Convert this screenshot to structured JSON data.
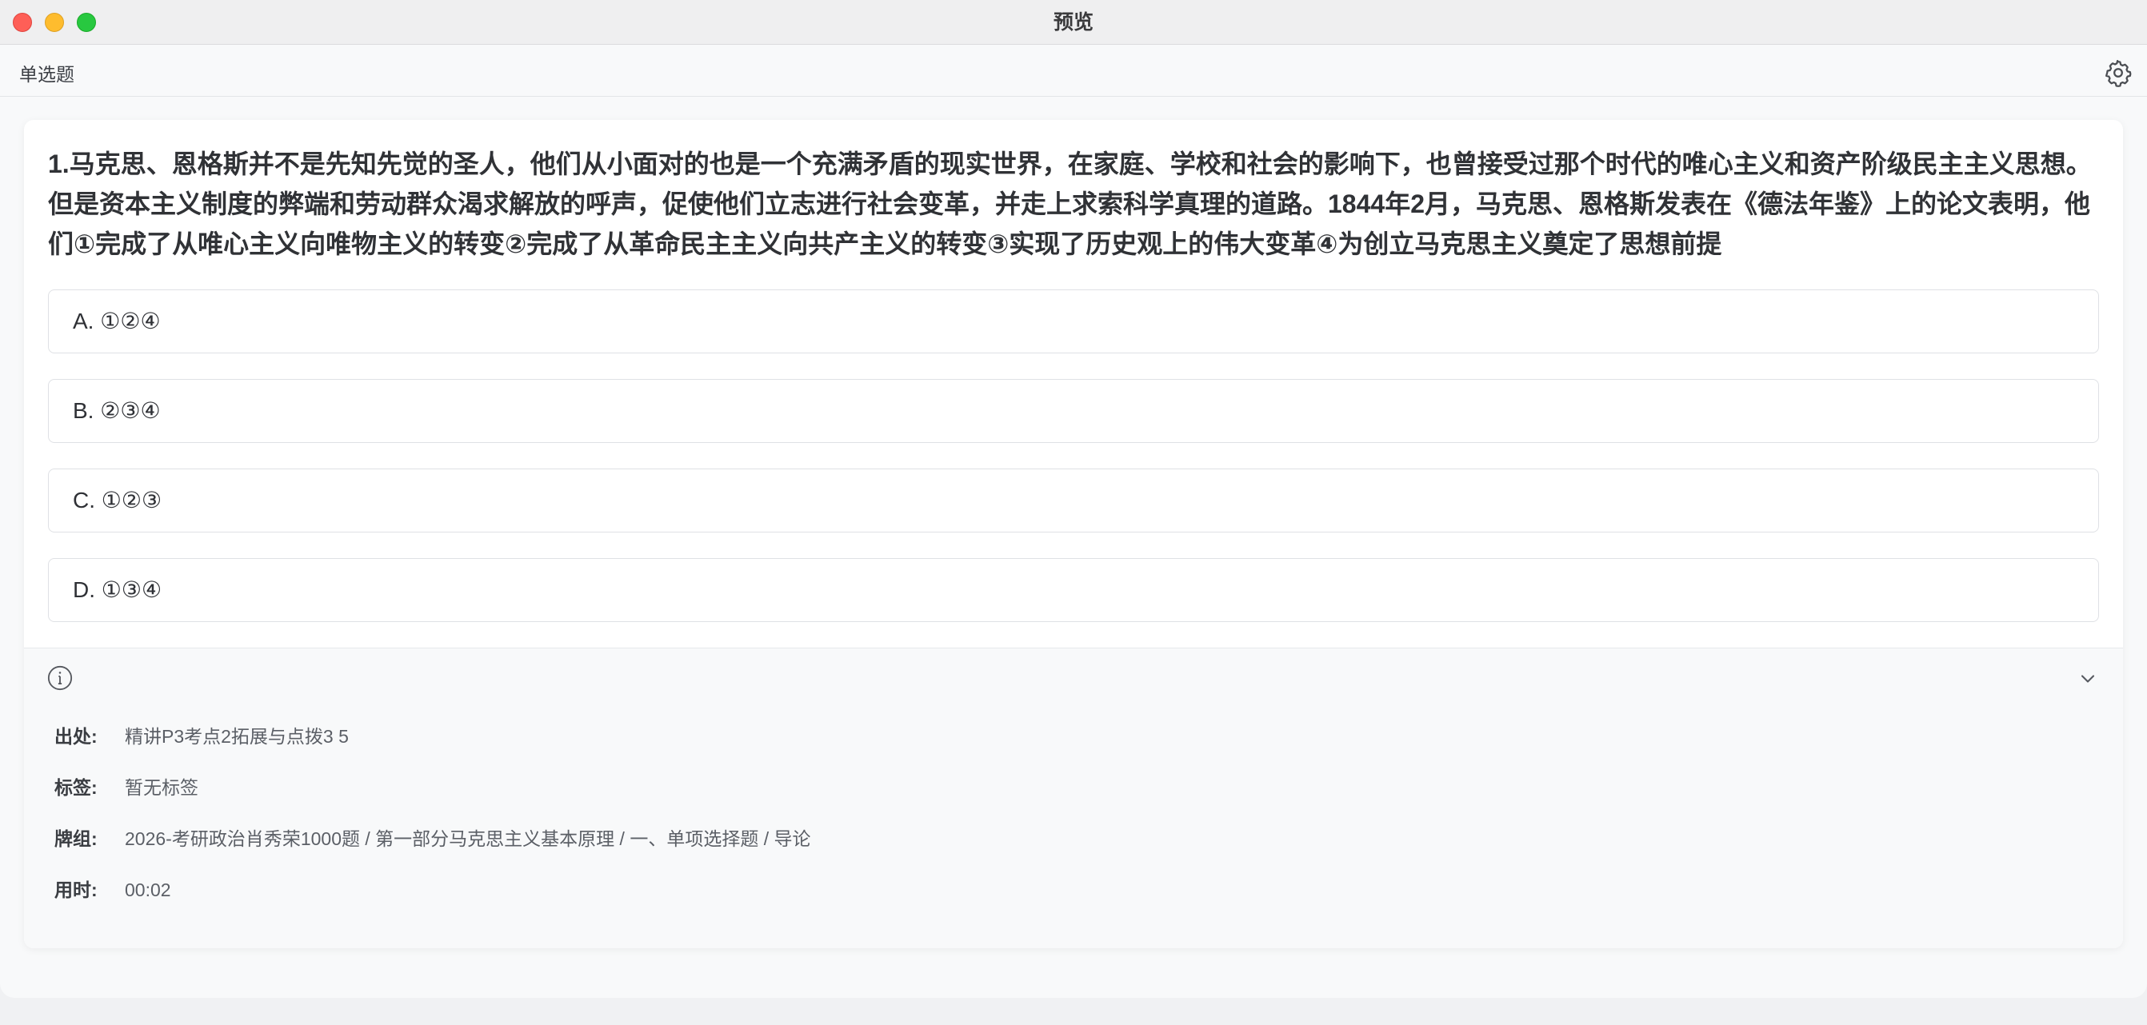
{
  "window": {
    "title": "预览"
  },
  "toolbar": {
    "mode_label": "单选题",
    "settings_icon": "gear-icon"
  },
  "question": {
    "text": "1.马克思、恩格斯并不是先知先觉的圣人，他们从小面对的也是一个充满矛盾的现实世界，在家庭、学校和社会的影响下，也曾接受过那个时代的唯心主义和资产阶级民主主义思想。但是资本主义制度的弊端和劳动群众渴求解放的呼声，促使他们立志进行社会变革，并走上求索科学真理的道路。1844年2月，马克思、恩格斯发表在《德法年鉴》上的论文表明，他们①完成了从唯心主义向唯物主义的转变②完成了从革命民主主义向共产主义的转变③实现了历史观上的伟大变革④为创立马克思主义奠定了思想前提",
    "options": [
      {
        "label": "A. ①②④"
      },
      {
        "label": "B. ②③④"
      },
      {
        "label": "C. ①②③"
      },
      {
        "label": "D. ①③④"
      }
    ]
  },
  "info": {
    "info_icon": "info-icon",
    "collapse_icon": "chevron-down-icon",
    "rows": [
      {
        "label": "出处:",
        "value": "精讲P3考点2拓展与点拨3  5"
      },
      {
        "label": "标签:",
        "value": "暂无标签"
      },
      {
        "label": "牌组:",
        "value": "2026-考研政治肖秀荣1000题 / 第一部分马克思主义基本原理 / 一、单项选择题 / 导论"
      },
      {
        "label": "用时:",
        "value": "00:02"
      }
    ]
  },
  "colors": {
    "window_bg": "#f8f9fa",
    "card_bg": "#ffffff",
    "border": "#dfe1e5",
    "close": "#fe5f57",
    "minimize": "#febc2e",
    "maximize": "#28c840"
  }
}
